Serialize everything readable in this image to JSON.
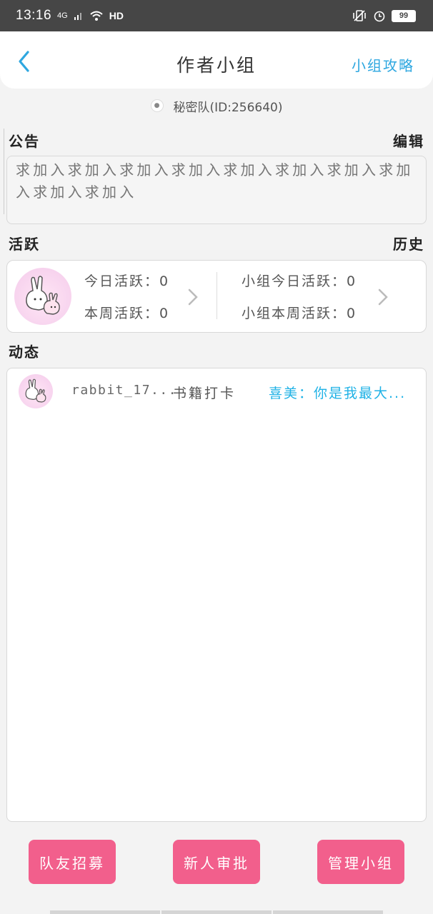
{
  "status": {
    "time": "13:16",
    "network": "4G",
    "hd": "HD",
    "battery": "99"
  },
  "header": {
    "title": "作者小组",
    "link_label": "小组攻略"
  },
  "team": {
    "name": "秘密队(ID:256640)"
  },
  "notice": {
    "label": "公告",
    "edit_label": "编辑",
    "content": "求加入求加入求加入求加入求加入求加入求加入求加入求加入求加入"
  },
  "activity": {
    "label": "活跃",
    "history_label": "历史",
    "today": "今日活跃：0",
    "week": "本周活跃：0",
    "group_today": "小组今日活跃：0",
    "group_week": "小组本周活跃：0"
  },
  "feed": {
    "label": "动态",
    "items": [
      {
        "user": "rabbit_17...",
        "type": "书籍打卡",
        "text": "喜美：你是我最大..."
      }
    ]
  },
  "buttons": {
    "recruit": "队友招募",
    "approve": "新人审批",
    "manage": "管理小组"
  },
  "colors": {
    "accent_blue": "#2ea7e0",
    "feed_blue": "#1fb2e6",
    "button_pink": "#f25f8c"
  }
}
